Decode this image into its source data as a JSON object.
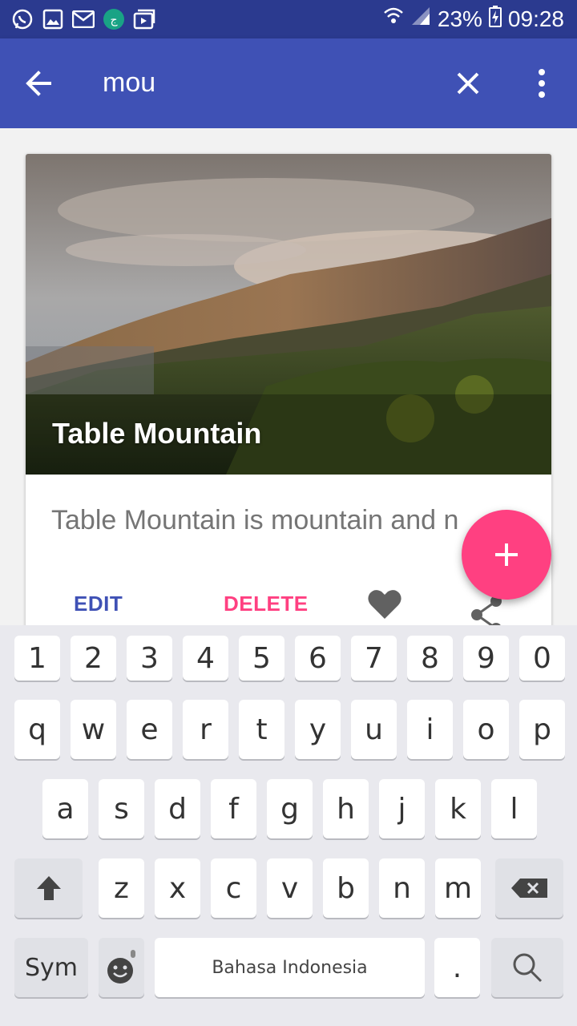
{
  "status_bar": {
    "battery": "23%",
    "time": "09:28",
    "left_icons": [
      "whatsapp-icon",
      "gallery-icon",
      "email-icon",
      "app-notification-icon",
      "media-icon"
    ],
    "right_icons": [
      "wifi-icon",
      "signal-icon",
      "battery-charging-icon"
    ]
  },
  "app_bar": {
    "search_query": "mou",
    "back_icon": "arrow-back-icon",
    "clear_icon": "close-icon",
    "menu_icon": "more-vert-icon",
    "background": "#3f51b5"
  },
  "card": {
    "title": "Table Mountain",
    "description": "Table Mountain is mountain and n",
    "actions": {
      "edit": "EDIT",
      "delete": "DELETE",
      "favorite_icon": "heart-icon",
      "share_icon": "share-icon"
    }
  },
  "fab": {
    "icon": "plus-icon",
    "color": "#ff4081"
  },
  "keyboard": {
    "number_row": [
      "1",
      "2",
      "3",
      "4",
      "5",
      "6",
      "7",
      "8",
      "9",
      "0"
    ],
    "row1": [
      "q",
      "w",
      "e",
      "r",
      "t",
      "y",
      "u",
      "i",
      "o",
      "p"
    ],
    "row2": [
      "a",
      "s",
      "d",
      "f",
      "g",
      "h",
      "j",
      "k",
      "l"
    ],
    "row3": [
      "z",
      "x",
      "c",
      "v",
      "b",
      "n",
      "m"
    ],
    "sym_label": "Sym",
    "space_label": "Bahasa Indonesia",
    "period_label": ".",
    "shift_icon": "shift-icon",
    "backspace_icon": "backspace-icon",
    "emoji_icon": "emoji-icon",
    "search_icon": "search-icon"
  }
}
